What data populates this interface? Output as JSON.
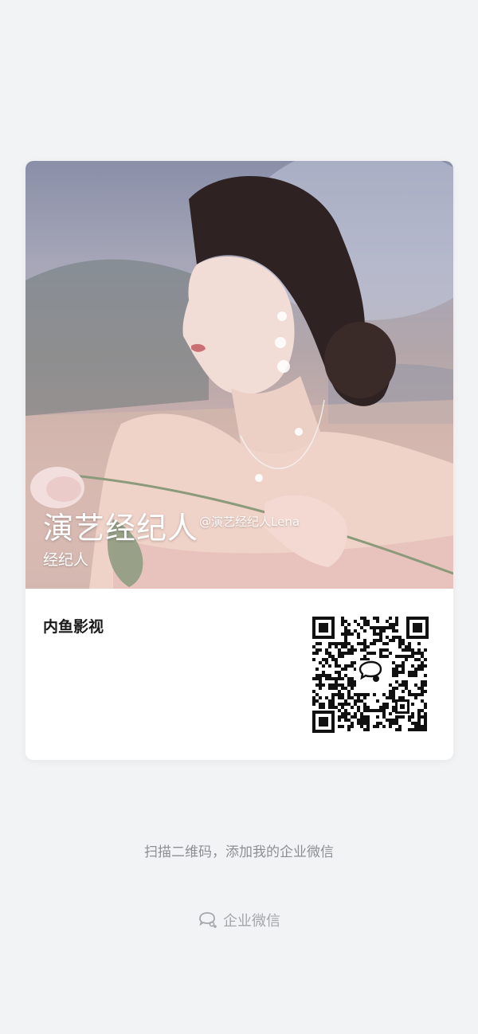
{
  "card": {
    "name": "演艺经纪人",
    "watermark": "@演艺经纪人Lena",
    "role": "经纪人",
    "company": "内鱼影视",
    "qr_icon": "wecom-logo-icon"
  },
  "hint": "扫描二维码，添加我的企业微信",
  "footer": {
    "icon": "wecom-logo-icon",
    "label": "企业微信"
  },
  "colors": {
    "background": "#f2f3f5",
    "card": "#ffffff",
    "text_dark": "#1b1b1b",
    "text_muted": "#8d8f94"
  }
}
